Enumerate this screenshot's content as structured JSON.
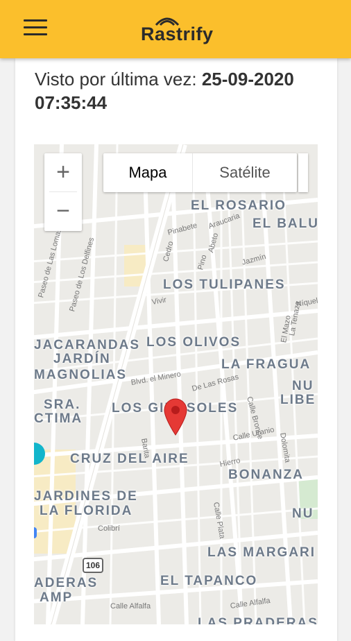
{
  "app": {
    "logo_text": "Rastrify"
  },
  "status": {
    "label": "Visto por última vez: ",
    "datetime": "25-09-2020 07:35:44"
  },
  "map": {
    "zoom_in": "+",
    "zoom_out": "−",
    "type_map": "Mapa",
    "type_satellite": "Satélite",
    "route_badge": "106",
    "neighborhoods": [
      "EL ROSARIO",
      "EL BALU",
      "LOS TULIPANES",
      "LOS OLIVOS",
      "LA FRAGUA",
      "JACARANDAS",
      "JARDÍN",
      "MAGNOLIAS",
      "NU",
      "LIBE",
      "SRA.",
      "CTIMA",
      "LOS GIRASOLES",
      "CRUZ DEL AIRE",
      "BONANZA",
      "JARDINES DE",
      "LA FLORIDA",
      "NU",
      "LAS MARGARI",
      "EL TAPANCO",
      "ADERAS",
      "AMP",
      "LAS PRADERAS"
    ],
    "streets": [
      "Pinabete",
      "Araucaria",
      "Cedro",
      "Abeto",
      "Pino",
      "Jazmín",
      "Vivir",
      "Níquel",
      "La Tenaza",
      "El Mazo",
      "Blvd. el Minero",
      "De Las Rosas",
      "Calle Bronce",
      "Dolomita",
      "Calle Uranio",
      "Barita",
      "Hierro",
      "Calle Plata",
      "Colibrí",
      "Calle Alfalfa",
      "Calle Alfalfa",
      "Paseo de Las Lomas",
      "Paseo de Los Delfines"
    ]
  }
}
